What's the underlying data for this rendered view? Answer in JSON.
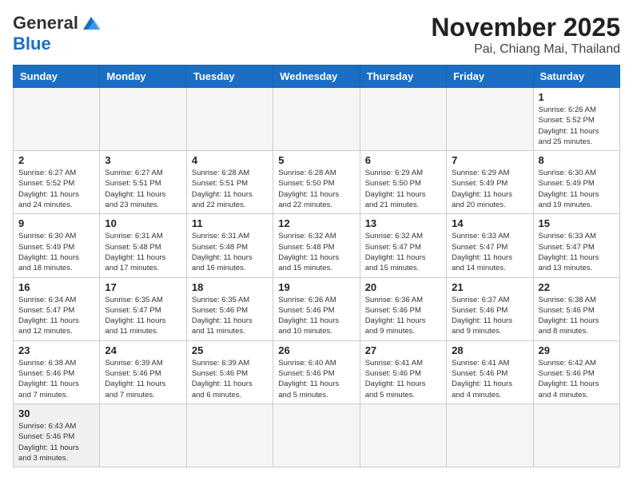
{
  "header": {
    "logo_general": "General",
    "logo_blue": "Blue",
    "month": "November 2025",
    "location": "Pai, Chiang Mai, Thailand"
  },
  "weekdays": [
    "Sunday",
    "Monday",
    "Tuesday",
    "Wednesday",
    "Thursday",
    "Friday",
    "Saturday"
  ],
  "weeks": [
    [
      {
        "day": "",
        "info": ""
      },
      {
        "day": "",
        "info": ""
      },
      {
        "day": "",
        "info": ""
      },
      {
        "day": "",
        "info": ""
      },
      {
        "day": "",
        "info": ""
      },
      {
        "day": "",
        "info": ""
      },
      {
        "day": "1",
        "info": "Sunrise: 6:26 AM\nSunset: 5:52 PM\nDaylight: 11 hours\nand 25 minutes."
      }
    ],
    [
      {
        "day": "2",
        "info": "Sunrise: 6:27 AM\nSunset: 5:52 PM\nDaylight: 11 hours\nand 24 minutes."
      },
      {
        "day": "3",
        "info": "Sunrise: 6:27 AM\nSunset: 5:51 PM\nDaylight: 11 hours\nand 23 minutes."
      },
      {
        "day": "4",
        "info": "Sunrise: 6:28 AM\nSunset: 5:51 PM\nDaylight: 11 hours\nand 22 minutes."
      },
      {
        "day": "5",
        "info": "Sunrise: 6:28 AM\nSunset: 5:50 PM\nDaylight: 11 hours\nand 22 minutes."
      },
      {
        "day": "6",
        "info": "Sunrise: 6:29 AM\nSunset: 5:50 PM\nDaylight: 11 hours\nand 21 minutes."
      },
      {
        "day": "7",
        "info": "Sunrise: 6:29 AM\nSunset: 5:49 PM\nDaylight: 11 hours\nand 20 minutes."
      },
      {
        "day": "8",
        "info": "Sunrise: 6:30 AM\nSunset: 5:49 PM\nDaylight: 11 hours\nand 19 minutes."
      }
    ],
    [
      {
        "day": "9",
        "info": "Sunrise: 6:30 AM\nSunset: 5:49 PM\nDaylight: 11 hours\nand 18 minutes."
      },
      {
        "day": "10",
        "info": "Sunrise: 6:31 AM\nSunset: 5:48 PM\nDaylight: 11 hours\nand 17 minutes."
      },
      {
        "day": "11",
        "info": "Sunrise: 6:31 AM\nSunset: 5:48 PM\nDaylight: 11 hours\nand 16 minutes."
      },
      {
        "day": "12",
        "info": "Sunrise: 6:32 AM\nSunset: 5:48 PM\nDaylight: 11 hours\nand 15 minutes."
      },
      {
        "day": "13",
        "info": "Sunrise: 6:32 AM\nSunset: 5:47 PM\nDaylight: 11 hours\nand 15 minutes."
      },
      {
        "day": "14",
        "info": "Sunrise: 6:33 AM\nSunset: 5:47 PM\nDaylight: 11 hours\nand 14 minutes."
      },
      {
        "day": "15",
        "info": "Sunrise: 6:33 AM\nSunset: 5:47 PM\nDaylight: 11 hours\nand 13 minutes."
      }
    ],
    [
      {
        "day": "16",
        "info": "Sunrise: 6:34 AM\nSunset: 5:47 PM\nDaylight: 11 hours\nand 12 minutes."
      },
      {
        "day": "17",
        "info": "Sunrise: 6:35 AM\nSunset: 5:47 PM\nDaylight: 11 hours\nand 11 minutes."
      },
      {
        "day": "18",
        "info": "Sunrise: 6:35 AM\nSunset: 5:46 PM\nDaylight: 11 hours\nand 11 minutes."
      },
      {
        "day": "19",
        "info": "Sunrise: 6:36 AM\nSunset: 5:46 PM\nDaylight: 11 hours\nand 10 minutes."
      },
      {
        "day": "20",
        "info": "Sunrise: 6:36 AM\nSunset: 5:46 PM\nDaylight: 11 hours\nand 9 minutes."
      },
      {
        "day": "21",
        "info": "Sunrise: 6:37 AM\nSunset: 5:46 PM\nDaylight: 11 hours\nand 9 minutes."
      },
      {
        "day": "22",
        "info": "Sunrise: 6:38 AM\nSunset: 5:46 PM\nDaylight: 11 hours\nand 8 minutes."
      }
    ],
    [
      {
        "day": "23",
        "info": "Sunrise: 6:38 AM\nSunset: 5:46 PM\nDaylight: 11 hours\nand 7 minutes."
      },
      {
        "day": "24",
        "info": "Sunrise: 6:39 AM\nSunset: 5:46 PM\nDaylight: 11 hours\nand 7 minutes."
      },
      {
        "day": "25",
        "info": "Sunrise: 6:39 AM\nSunset: 5:46 PM\nDaylight: 11 hours\nand 6 minutes."
      },
      {
        "day": "26",
        "info": "Sunrise: 6:40 AM\nSunset: 5:46 PM\nDaylight: 11 hours\nand 5 minutes."
      },
      {
        "day": "27",
        "info": "Sunrise: 6:41 AM\nSunset: 5:46 PM\nDaylight: 11 hours\nand 5 minutes."
      },
      {
        "day": "28",
        "info": "Sunrise: 6:41 AM\nSunset: 5:46 PM\nDaylight: 11 hours\nand 4 minutes."
      },
      {
        "day": "29",
        "info": "Sunrise: 6:42 AM\nSunset: 5:46 PM\nDaylight: 11 hours\nand 4 minutes."
      }
    ],
    [
      {
        "day": "30",
        "info": "Sunrise: 6:43 AM\nSunset: 5:46 PM\nDaylight: 11 hours\nand 3 minutes."
      },
      {
        "day": "",
        "info": ""
      },
      {
        "day": "",
        "info": ""
      },
      {
        "day": "",
        "info": ""
      },
      {
        "day": "",
        "info": ""
      },
      {
        "day": "",
        "info": ""
      },
      {
        "day": "",
        "info": ""
      }
    ]
  ]
}
